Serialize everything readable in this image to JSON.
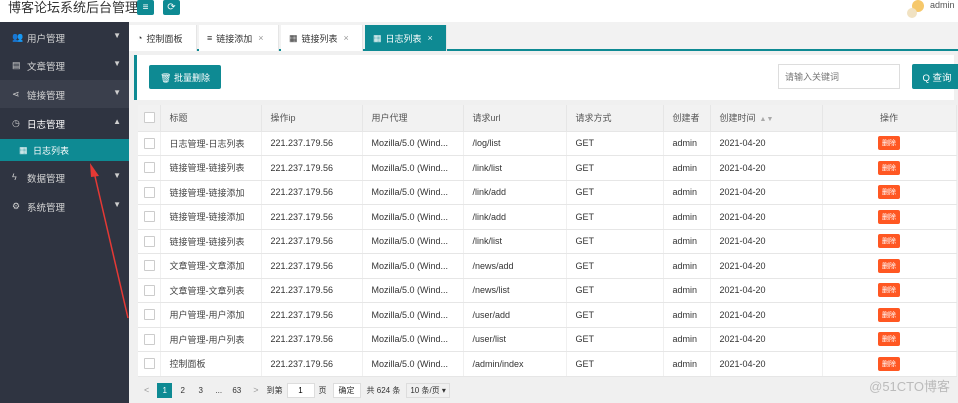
{
  "header": {
    "brand": "博客论坛系统后台管理",
    "menu_btn_icon": "≡",
    "refresh_btn_icon": "⟳",
    "user_name": "admin"
  },
  "sidebar": {
    "items": [
      {
        "label": "用户管理",
        "icon": "users-icon",
        "glyph": "👥",
        "caret": "▼"
      },
      {
        "label": "文章管理",
        "icon": "document-icon",
        "glyph": "▤",
        "caret": "▼"
      },
      {
        "label": "链接管理",
        "icon": "share-icon",
        "glyph": "⋖",
        "caret": "▼"
      },
      {
        "label": "日志管理",
        "icon": "clock-icon",
        "glyph": "◷",
        "caret": "▲"
      },
      {
        "label": "数据管理",
        "icon": "bolt-icon",
        "glyph": "ϟ",
        "caret": "▼"
      },
      {
        "label": "系统管理",
        "icon": "gears-icon",
        "glyph": "⚙",
        "caret": "▼"
      }
    ],
    "sub_item": {
      "label": "日志列表",
      "glyph": "▦"
    }
  },
  "tabs": [
    {
      "label": "控制面板",
      "glyph": "◔",
      "close": ""
    },
    {
      "label": "链接添加",
      "glyph": "≡",
      "close": "×"
    },
    {
      "label": "链接列表",
      "glyph": "▦",
      "close": "×"
    },
    {
      "label": "日志列表",
      "glyph": "▦",
      "close": "×"
    }
  ],
  "toolbar": {
    "batch_delete": "🗑 批量删除",
    "search_placeholder": "请输入关键词",
    "search_btn": "Q 查询"
  },
  "table": {
    "columns": [
      "标题",
      "操作ip",
      "用户代理",
      "请求url",
      "请求方式",
      "创建者",
      "创建时间",
      "操作"
    ],
    "sort_glyph": "▲▼",
    "delete_label": "删除",
    "rows": [
      {
        "title": "日志管理-日志列表",
        "ip": "221.237.179.56",
        "agent": "Mozilla/5.0 (Wind...",
        "url": "/log/list",
        "method": "GET",
        "creator": "admin",
        "time": "2021-04-20"
      },
      {
        "title": "链接管理-链接列表",
        "ip": "221.237.179.56",
        "agent": "Mozilla/5.0 (Wind...",
        "url": "/link/list",
        "method": "GET",
        "creator": "admin",
        "time": "2021-04-20"
      },
      {
        "title": "链接管理-链接添加",
        "ip": "221.237.179.56",
        "agent": "Mozilla/5.0 (Wind...",
        "url": "/link/add",
        "method": "GET",
        "creator": "admin",
        "time": "2021-04-20"
      },
      {
        "title": "链接管理-链接添加",
        "ip": "221.237.179.56",
        "agent": "Mozilla/5.0 (Wind...",
        "url": "/link/add",
        "method": "GET",
        "creator": "admin",
        "time": "2021-04-20"
      },
      {
        "title": "链接管理-链接列表",
        "ip": "221.237.179.56",
        "agent": "Mozilla/5.0 (Wind...",
        "url": "/link/list",
        "method": "GET",
        "creator": "admin",
        "time": "2021-04-20"
      },
      {
        "title": "文章管理-文章添加",
        "ip": "221.237.179.56",
        "agent": "Mozilla/5.0 (Wind...",
        "url": "/news/add",
        "method": "GET",
        "creator": "admin",
        "time": "2021-04-20"
      },
      {
        "title": "文章管理-文章列表",
        "ip": "221.237.179.56",
        "agent": "Mozilla/5.0 (Wind...",
        "url": "/news/list",
        "method": "GET",
        "creator": "admin",
        "time": "2021-04-20"
      },
      {
        "title": "用户管理-用户添加",
        "ip": "221.237.179.56",
        "agent": "Mozilla/5.0 (Wind...",
        "url": "/user/add",
        "method": "GET",
        "creator": "admin",
        "time": "2021-04-20"
      },
      {
        "title": "用户管理-用户列表",
        "ip": "221.237.179.56",
        "agent": "Mozilla/5.0 (Wind...",
        "url": "/user/list",
        "method": "GET",
        "creator": "admin",
        "time": "2021-04-20"
      },
      {
        "title": "控制面板",
        "ip": "221.237.179.56",
        "agent": "Mozilla/5.0 (Wind...",
        "url": "/admin/index",
        "method": "GET",
        "creator": "admin",
        "time": "2021-04-20"
      }
    ]
  },
  "pager": {
    "prev": "<",
    "pages": [
      "1",
      "2",
      "3",
      "...",
      "63"
    ],
    "current_page": "1",
    "next": ">",
    "goto_label": "到第",
    "goto_value": "1",
    "page_unit": "页",
    "confirm": "确定",
    "total": "共 624 条",
    "page_size": "10 条/页 ▾"
  },
  "watermark": "@51CTO博客",
  "colors": {
    "accent": "#0e8a93",
    "sidebar": "#2f3441",
    "danger": "#ff5722",
    "annotation": "#e53935"
  }
}
